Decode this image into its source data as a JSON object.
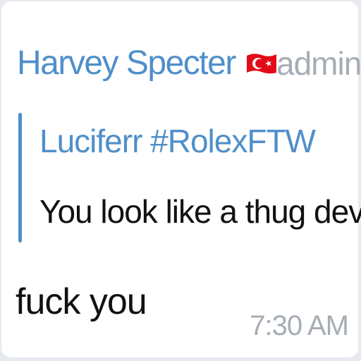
{
  "message": {
    "sender_name": "Harvey Specter",
    "sender_flag_icon": "turkey-flag-icon",
    "sender_role": "admin",
    "reply": {
      "author": "Luciferr #RolexFTW",
      "text": "You look like a thug dev"
    },
    "text": "fuck you",
    "time": "7:30 AM"
  },
  "colors": {
    "accent": "#4f8fc9",
    "muted": "#a6adb5",
    "flag_red": "#e30a17",
    "bubble": "#ffffff",
    "background": "#e7ebef"
  }
}
